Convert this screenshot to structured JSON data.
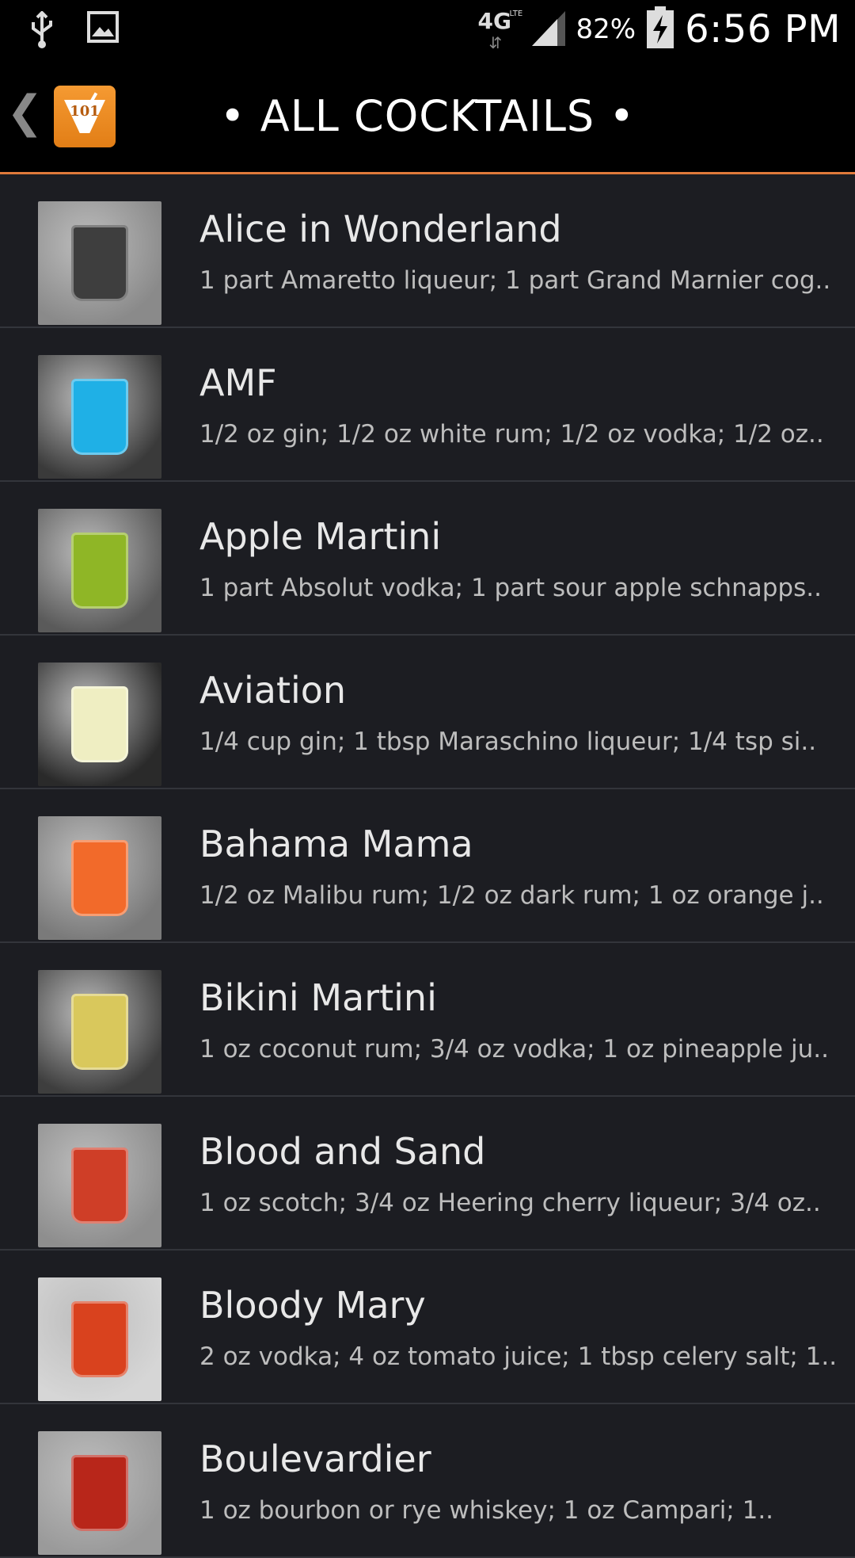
{
  "status": {
    "network": "4G",
    "network_sub": "LTE",
    "battery_percent": "82%",
    "time": "6:56 PM"
  },
  "header": {
    "title": "• ALL COCKTAILS •",
    "app_icon_label": "101"
  },
  "cocktails": [
    {
      "name": "Alice in Wonderland",
      "ingredients": "1 part Amaretto liqueur; 1 part Grand Marnier cog..",
      "thumb_bg": "#8a8a8a",
      "drink_color": "#3e3e3e"
    },
    {
      "name": "AMF",
      "ingredients": "1/2 oz gin; 1/2 oz white rum; 1/2 oz vodka; 1/2 oz..",
      "thumb_bg": "#3a3a3a",
      "drink_color": "#1fb0e6"
    },
    {
      "name": "Apple Martini",
      "ingredients": "1 part Absolut vodka; 1 part sour apple schnapps..",
      "thumb_bg": "#5a5a5a",
      "drink_color": "#8fb626"
    },
    {
      "name": "Aviation",
      "ingredients": "1/4 cup gin; 1 tbsp Maraschino liqueur; 1/4 tsp si..",
      "thumb_bg": "#2a2a2a",
      "drink_color": "#efeec2"
    },
    {
      "name": "Bahama Mama",
      "ingredients": "1/2 oz Malibu rum; 1/2 oz dark rum; 1 oz orange j..",
      "thumb_bg": "#7a7a7a",
      "drink_color": "#f26a2a"
    },
    {
      "name": "Bikini Martini",
      "ingredients": "1 oz coconut rum; 3/4 oz vodka; 1 oz pineapple ju..",
      "thumb_bg": "#3e3e3e",
      "drink_color": "#d9c85c"
    },
    {
      "name": "Blood and Sand",
      "ingredients": "1 oz scotch; 3/4 oz Heering cherry liqueur; 3/4 oz..",
      "thumb_bg": "#8e8e8e",
      "drink_color": "#cf3e27"
    },
    {
      "name": "Bloody Mary",
      "ingredients": "2 oz vodka; 4 oz tomato juice; 1 tbsp celery salt; 1..",
      "thumb_bg": "#d6d6d6",
      "drink_color": "#d9421e"
    },
    {
      "name": "Boulevardier",
      "ingredients": "1 oz bourbon or rye whiskey; 1 oz Campari; 1..",
      "thumb_bg": "#9a9a9a",
      "drink_color": "#b8261a"
    }
  ]
}
